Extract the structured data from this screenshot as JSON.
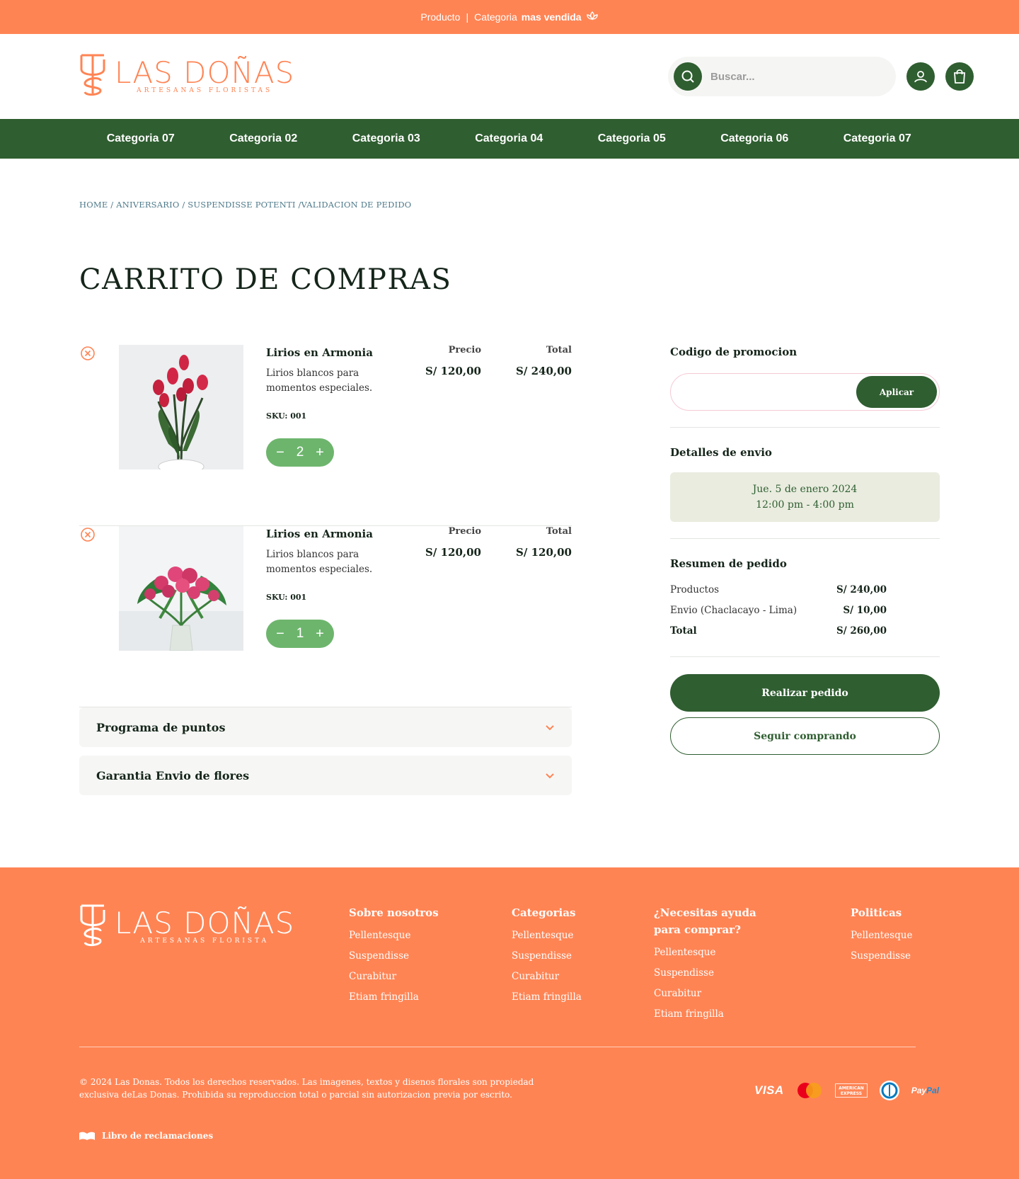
{
  "topbar": {
    "producto": "Producto",
    "separator": "|",
    "categoria": "Categoria",
    "highlight": "mas vendida"
  },
  "brand": {
    "name": "LAS DOÑAS",
    "tagline": "ARTESANAS FLORISTAS",
    "footer_tagline": "ARTESANAS FLORISTA",
    "accent": "#ff8454",
    "green": "#2f5e30"
  },
  "search": {
    "placeholder": "Buscar..."
  },
  "nav": {
    "items": [
      "Categoria 07",
      "Categoria 02",
      "Categoria 03",
      "Categoria 04",
      "Categoria 05",
      "Categoria 06",
      "Categoria 07"
    ]
  },
  "breadcrumb": "HOME / ANIVERSARIO / SUSPENDISSE POTENTI /VALIDACION DE PEDIDO",
  "page_title": "CARRITO DE COMPRAS",
  "cart": {
    "price_header": "Precio",
    "total_header": "Total",
    "items": [
      {
        "name": "Lirios en Armonia",
        "description": "Lirios blancos para momentos especiales.",
        "sku": "SKU: 001",
        "quantity": "2",
        "price": "S/ 120,00",
        "total": "S/ 240,00"
      },
      {
        "name": "Lirios en Armonia",
        "description": "Lirios blancos para momentos especiales.",
        "sku": "SKU: 001",
        "quantity": "1",
        "price": "S/ 120,00",
        "total": "S/ 120,00"
      }
    ]
  },
  "accordions": [
    "Programa de puntos",
    "Garantia Envio de flores"
  ],
  "promo": {
    "title": "Codigo de promocion",
    "placeholder": "",
    "apply": "Aplicar"
  },
  "shipping": {
    "title": "Detalles de envio",
    "date": "Jue. 5 de enero 2024",
    "time": "12:00 pm - 4:00 pm"
  },
  "summary": {
    "title": "Resumen de pedido",
    "products_label": "Productos",
    "products_value": "S/ 240,00",
    "shipping_label": "Envio (Chaclacayo - Lima)",
    "shipping_value": "S/ 10,00",
    "total_label": "Total",
    "total_value": "S/ 260,00"
  },
  "actions": {
    "checkout": "Realizar pedido",
    "continue": "Seguir comprando"
  },
  "footer": {
    "columns": [
      {
        "title": "Sobre nosotros",
        "links": [
          "Pellentesque",
          "Suspendisse",
          "Curabitur",
          "Etiam fringilla"
        ]
      },
      {
        "title": "Categorias",
        "links": [
          "Pellentesque",
          "Suspendisse",
          "Curabitur",
          "Etiam fringilla"
        ]
      },
      {
        "title": "¿Necesitas ayuda para comprar?",
        "links": [
          "Pellentesque",
          "Suspendisse",
          "Curabitur",
          "Etiam fringilla"
        ]
      },
      {
        "title": "Politicas",
        "links": [
          "Pellentesque",
          "Suspendisse"
        ]
      }
    ],
    "copyright": "© 2024 Las Donas. Todos los derechos reservados. Las imagenes, textos y disenos florales son propiedad exclusiva deLas Donas. Prohibida su reproduccion total o parcial sin autorizacion previa por escrito.",
    "complaints": "Libro de reclamaciones",
    "payments": [
      "VISA",
      "mastercard",
      "AMERICAN EXPRESS",
      "diners-club",
      "PayPal"
    ]
  }
}
